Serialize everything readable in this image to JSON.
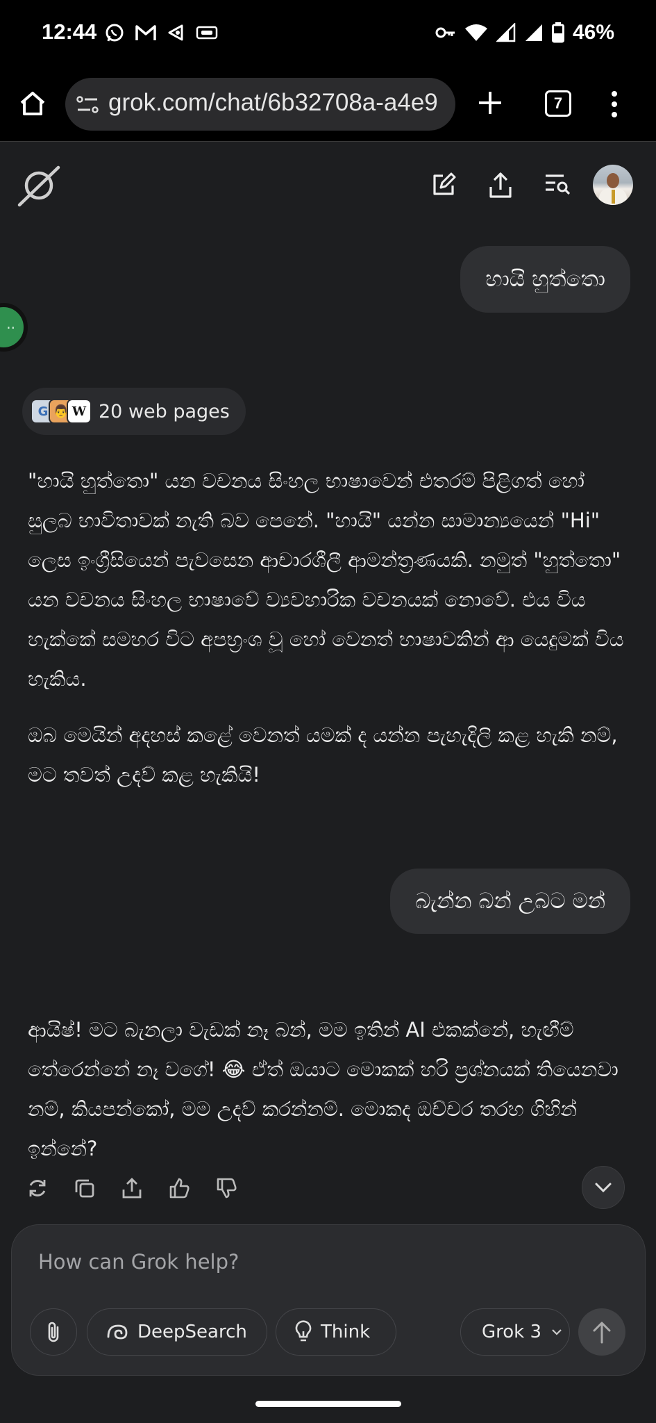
{
  "status_bar": {
    "time": "12:44",
    "battery": "46%",
    "left_icons": [
      "whatsapp-icon",
      "gmail-icon",
      "threads-icon",
      "vpn-icon"
    ],
    "right_icons": [
      "key-icon",
      "wifi-icon",
      "signal-icon",
      "signal-icon",
      "battery-icon"
    ]
  },
  "browser": {
    "url": "grok.com/chat/6b32708a-a4e9",
    "tab_count": "7"
  },
  "header": {
    "icons": [
      "grok-logo-icon",
      "new-chat-icon",
      "share-icon",
      "history-icon",
      "avatar"
    ]
  },
  "conversation": {
    "user_message_1": "හායි හුත්තො",
    "sources_label": "20 web pages",
    "source_icons": [
      "G",
      "👨",
      "W"
    ],
    "answer_1_p1": "\"හායි හුත්තො\" යන වචනය සිංහල භාෂාවෙන් එතරම් පිළිගත් හෝ සුලබ භාවිතාවක් නැති බව පෙනේ. \"හායි\" යන්න සාමාන්‍යයෙන් \"Hi\" ලෙස ඉංග්‍රීසියෙන් පැවසෙන ආචාරශීලී ආමන්ත්‍රණයකි. නමුත් \"හුත්තො\" යන වචනය සිංහල භාෂාවේ ව්‍යවහාරික වචනයක් නොවේ. එය විය හැක්කේ සමහර විට අපභ්‍රංශ වූ හෝ වෙනත් භාෂාවකින් ආ යෙදුමක් විය හැකිය.",
    "answer_1_p2": "ඔබ මෙයින් අදහස් කළේ වෙනත් යමක් ද යන්න පැහැදිලි කළ හැකි නම්, මට තවත් උදව් කළ හැකියි!",
    "user_message_2": "බැන්න බන් උබට මන්",
    "answer_2": "ආයිෂ්! මට බැනලා වැඩක් නෑ බන්, මම ඉතින් AI එකක්නේ, හැඟීම් තේරෙන්නේ නෑ වගේ! 😂 ඒත් ඔයාට මොකක් හරි ප්‍රශ්නයක් තියෙනවා නම්, කියපන්කෝ, මම උදව් කරන්නම්. මොකද ඔච්චර තරහ ගිහින් ඉන්නේ?"
  },
  "composer": {
    "placeholder": "How can Grok help?",
    "deepsearch_label": "DeepSearch",
    "think_label": "Think",
    "model_label": "Grok 3"
  }
}
